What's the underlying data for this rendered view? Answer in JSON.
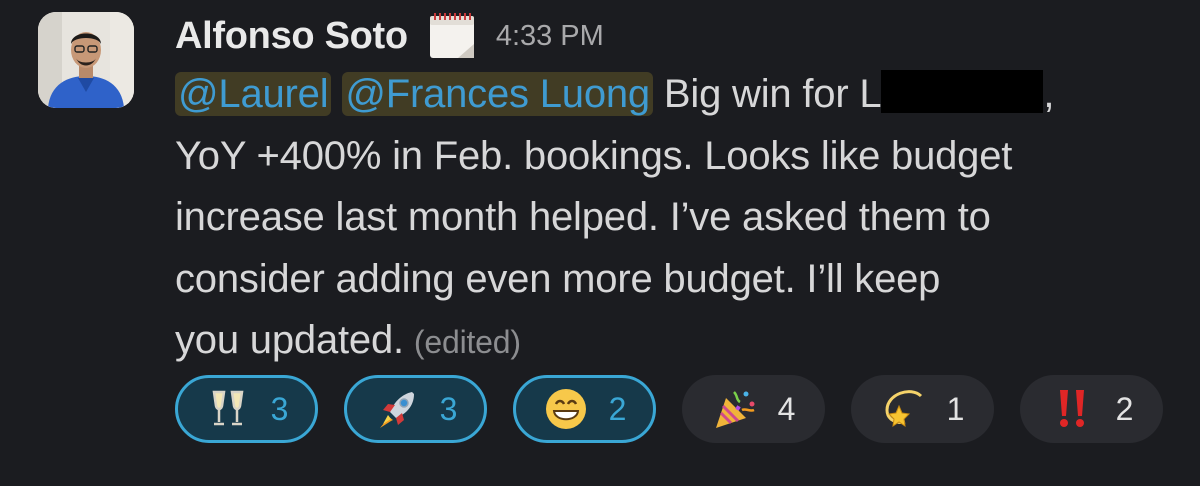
{
  "message": {
    "author": "Alfonso Soto",
    "status_icon": "calendar-status-icon",
    "timestamp": "4:33 PM",
    "mentions": [
      "@Laurel",
      "@Frances Luong"
    ],
    "text_line1_prefix": "Big win for L",
    "text_line1_suffix": ",",
    "text_line2": "YoY +400% in Feb. bookings. Looks like budget",
    "text_line3": "increase last month helped. I’ve asked them to",
    "text_line4": "consider adding even more budget. I’ll keep",
    "text_line5": "you updated.",
    "edited_label": "(edited)"
  },
  "reactions": [
    {
      "icon": "champagne-glasses-icon",
      "count": "3",
      "active": true
    },
    {
      "icon": "rocket-icon",
      "count": "3",
      "active": true
    },
    {
      "icon": "grinning-face-icon",
      "count": "2",
      "active": true
    },
    {
      "icon": "party-popper-icon",
      "count": "4",
      "active": false
    },
    {
      "icon": "dizzy-star-icon",
      "count": "1",
      "active": false
    },
    {
      "icon": "double-exclamation-icon",
      "count": "2",
      "active": false
    }
  ],
  "colors": {
    "background": "#1b1c20",
    "mention_text": "#3f9bd1",
    "mention_bg": "#413c24",
    "reaction_active_border": "#3aa7d5",
    "reaction_bg": "#2a2b30"
  }
}
